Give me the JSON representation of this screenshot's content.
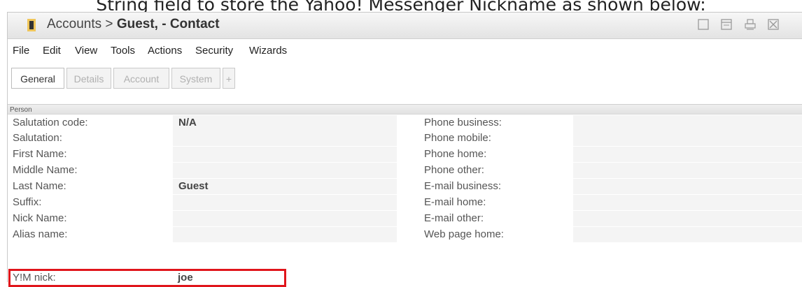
{
  "caption": "String field to store the Yahoo! Messenger Nickname as shown below:",
  "title": {
    "prefix": "Accounts > ",
    "bold": "Guest, - Contact"
  },
  "menu": [
    "File",
    "Edit",
    "View",
    "Tools",
    "Actions",
    "Security",
    "Wizards"
  ],
  "tabs": [
    {
      "label": "General",
      "active": true
    },
    {
      "label": "Details",
      "active": false
    },
    {
      "label": "Account",
      "active": false
    },
    {
      "label": "System",
      "active": false
    },
    {
      "label": "+",
      "active": false
    }
  ],
  "group": "Person",
  "left_fields": [
    {
      "label": "Salutation code:",
      "value": "N/A"
    },
    {
      "label": "Salutation:",
      "value": ""
    },
    {
      "label": "First Name:",
      "value": ""
    },
    {
      "label": "Middle Name:",
      "value": ""
    },
    {
      "label": "Last Name:",
      "value": "Guest"
    },
    {
      "label": "Suffix:",
      "value": ""
    },
    {
      "label": "Nick Name:",
      "value": ""
    },
    {
      "label": "Alias name:",
      "value": ""
    }
  ],
  "right_fields": [
    {
      "label": "Phone business:",
      "value": ""
    },
    {
      "label": "Phone mobile:",
      "value": ""
    },
    {
      "label": "Phone home:",
      "value": ""
    },
    {
      "label": "Phone other:",
      "value": ""
    },
    {
      "label": "E-mail business:",
      "value": ""
    },
    {
      "label": "E-mail home:",
      "value": ""
    },
    {
      "label": "E-mail other:",
      "value": ""
    },
    {
      "label": "Web page home:",
      "value": ""
    }
  ],
  "ym": {
    "label": "Y!M nick:",
    "value": "joe"
  },
  "colors": {
    "highlight": "#e0151b",
    "field_bg": "#f4f4f4"
  }
}
